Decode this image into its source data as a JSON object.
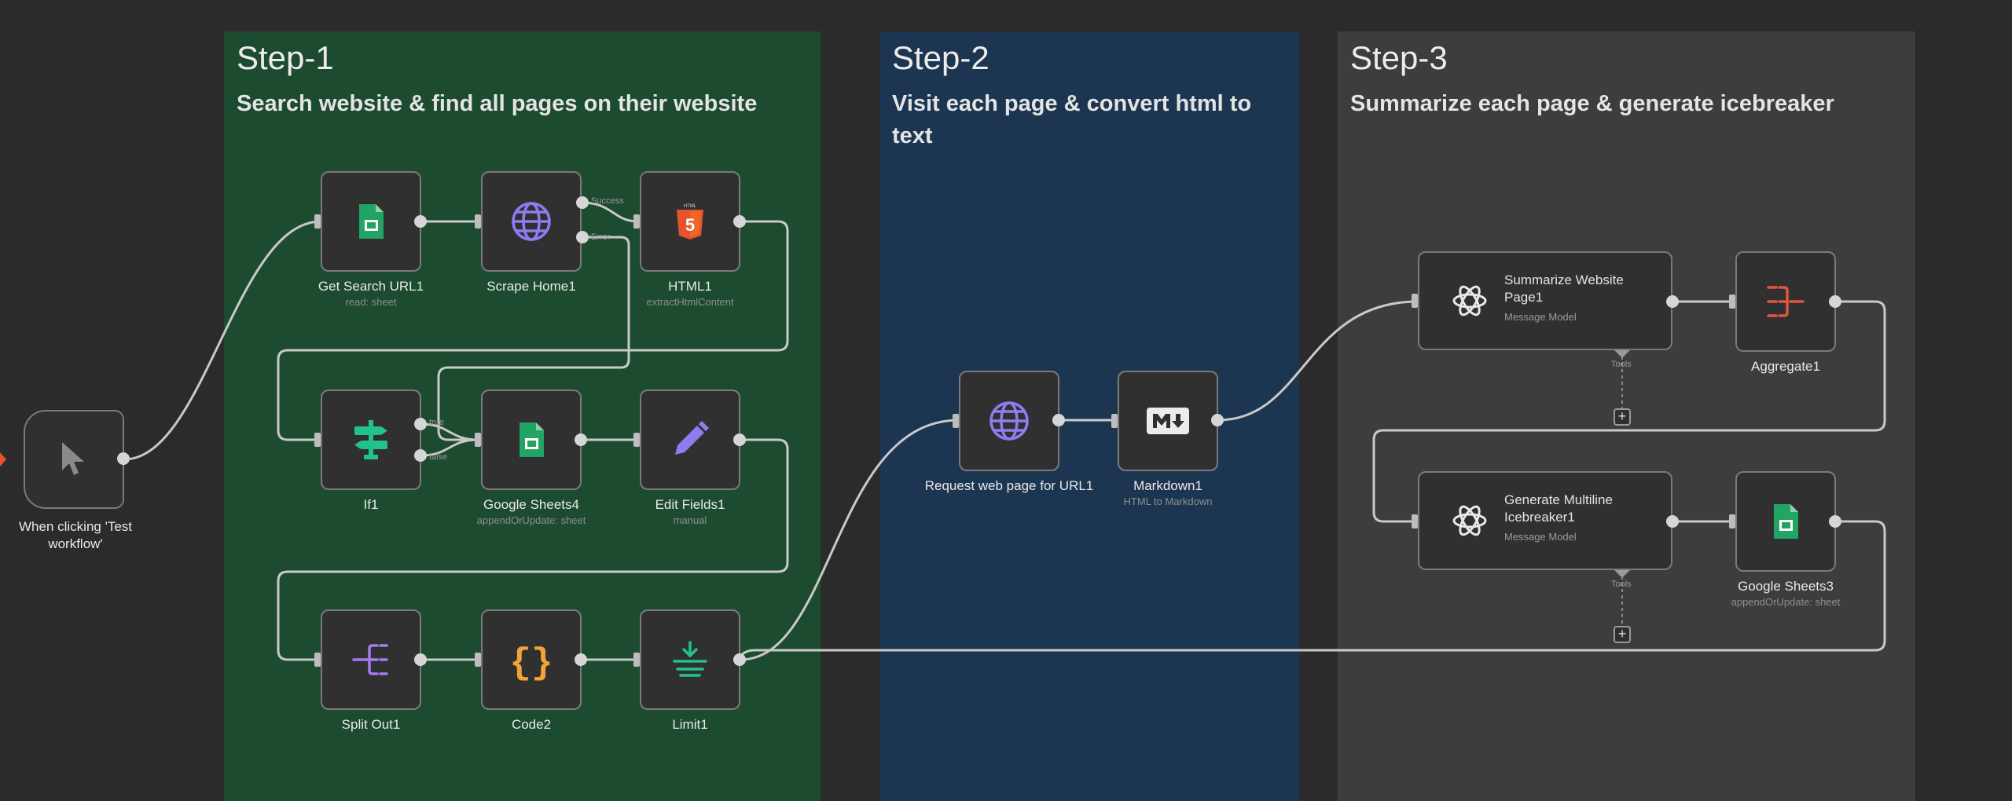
{
  "steps": [
    {
      "title": "Step-1",
      "description": "Search website & find all pages on their website"
    },
    {
      "title": "Step-2",
      "description": "Visit each page & convert html to text"
    },
    {
      "title": "Step-3",
      "description": "Summarize each page & generate icebreaker"
    }
  ],
  "nodes": {
    "trigger": {
      "name": "When clicking 'Test workflow'"
    },
    "get_search_url": {
      "name": "Get Search URL1",
      "subtitle": "read: sheet"
    },
    "scrape_home": {
      "name": "Scrape Home1",
      "branch_success": "Success",
      "branch_error": "Error"
    },
    "html1": {
      "name": "HTML1",
      "subtitle": "extractHtmlContent"
    },
    "if1": {
      "name": "If1",
      "branch_true": "true",
      "branch_false": "false"
    },
    "google_sheets4": {
      "name": "Google Sheets4",
      "subtitle": "appendOrUpdate: sheet"
    },
    "edit_fields": {
      "name": "Edit Fields1",
      "subtitle": "manual"
    },
    "split_out": {
      "name": "Split Out1"
    },
    "code2": {
      "name": "Code2"
    },
    "limit1": {
      "name": "Limit1"
    },
    "request_web_page": {
      "name": "Request web page for URL1"
    },
    "markdown1": {
      "name": "Markdown1",
      "subtitle": "HTML to Markdown"
    },
    "summarize": {
      "name": "Summarize Website Page1",
      "subtitle": "Message Model",
      "port_label": "Tools"
    },
    "aggregate": {
      "name": "Aggregate1"
    },
    "generate_icebreaker": {
      "name": "Generate Multiline Icebreaker1",
      "subtitle": "Message Model",
      "port_label": "Tools"
    },
    "google_sheets3": {
      "name": "Google Sheets3",
      "subtitle": "appendOrUpdate: sheet"
    }
  },
  "colors": {
    "canvas": "#2b2b2b",
    "step1": "#1d4b30",
    "step2": "#1c3551",
    "step3": "#3d3d3d",
    "wire": "#c9c9c9",
    "sheets_green": "#21a464",
    "globe_purple": "#8f7cf0",
    "html_orange": "#e5532d",
    "code_orange": "#f3a23a",
    "aggregate_red": "#e0553f"
  },
  "icons": [
    "cursor-icon",
    "google-sheets-icon",
    "globe-icon",
    "html5-icon",
    "if-icon",
    "pencil-icon",
    "split-out-icon",
    "code-braces-icon",
    "limit-icon",
    "markdown-icon",
    "openai-icon",
    "aggregate-icon"
  ]
}
